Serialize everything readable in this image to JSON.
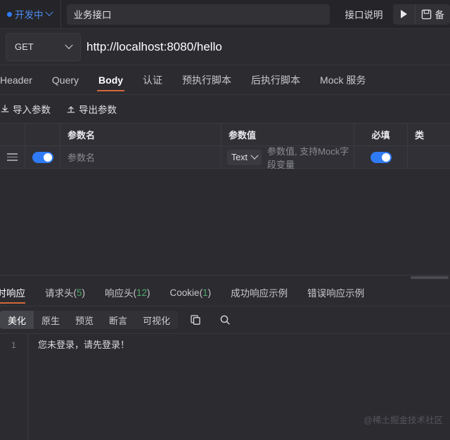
{
  "topbar": {
    "status_label": "开发中",
    "status_icon": "blue-dot",
    "chevron_icon": "chevron-down-icon",
    "api_name": "业务接口",
    "doc_button": "接口说明",
    "run_icon": "play-icon",
    "save_icon": "save-icon",
    "save_label": "备"
  },
  "urlbar": {
    "method": "GET",
    "method_chevron": "chevron-down-icon",
    "url": "http://localhost:8080/hello"
  },
  "request_tabs": [
    {
      "label": "Header",
      "active": false
    },
    {
      "label": "Query",
      "active": false
    },
    {
      "label": "Body",
      "active": true
    },
    {
      "label": "认证",
      "active": false
    },
    {
      "label": "预执行脚本",
      "active": false
    },
    {
      "label": "后执行脚本",
      "active": false
    },
    {
      "label": "Mock 服务",
      "active": false
    }
  ],
  "io_buttons": [
    {
      "label": "导入参数",
      "icon": "import-icon"
    },
    {
      "label": "导出参数",
      "icon": "export-icon"
    }
  ],
  "param_table": {
    "headers": {
      "drag": "",
      "enable": "",
      "name": "参数名",
      "value": "参数值",
      "required": "必填",
      "last": "类"
    },
    "rows": [
      {
        "drag_icon": "drag-handle-icon",
        "enabled": true,
        "name_placeholder": "参数名",
        "type": "Text",
        "type_chevron": "chevron-down-icon",
        "value_placeholder": "参数值, 支持Mock字段变量",
        "required": true
      }
    ]
  },
  "response_tabs": [
    {
      "label": "实时响应",
      "count": "",
      "active": true
    },
    {
      "label": "请求头",
      "count": "5",
      "active": false
    },
    {
      "label": "响应头",
      "count": "12",
      "active": false
    },
    {
      "label": "Cookie",
      "count": "1",
      "active": false
    },
    {
      "label": "成功响应示例",
      "count": "",
      "active": false
    },
    {
      "label": "错误响应示例",
      "count": "",
      "active": false
    }
  ],
  "view_bar": {
    "segments": [
      {
        "label": "美化",
        "active": true
      },
      {
        "label": "原生",
        "active": false
      },
      {
        "label": "预览",
        "active": false
      },
      {
        "label": "断言",
        "active": false
      },
      {
        "label": "可视化",
        "active": false
      }
    ],
    "copy_icon": "copy-icon",
    "search_icon": "search-icon"
  },
  "response_body": {
    "lines": [
      {
        "number": "1",
        "text": "您未登录，请先登录！"
      }
    ],
    "watermark": "@稀土掘金技术社区"
  },
  "colors": {
    "background": "#2b2b30",
    "panel": "#252529",
    "accent_orange": "#d4673a",
    "accent_blue": "#2f7bf5",
    "count_green": "#4fa96c",
    "text_primary": "#e2e2e4",
    "text_muted": "#8a8a91"
  }
}
